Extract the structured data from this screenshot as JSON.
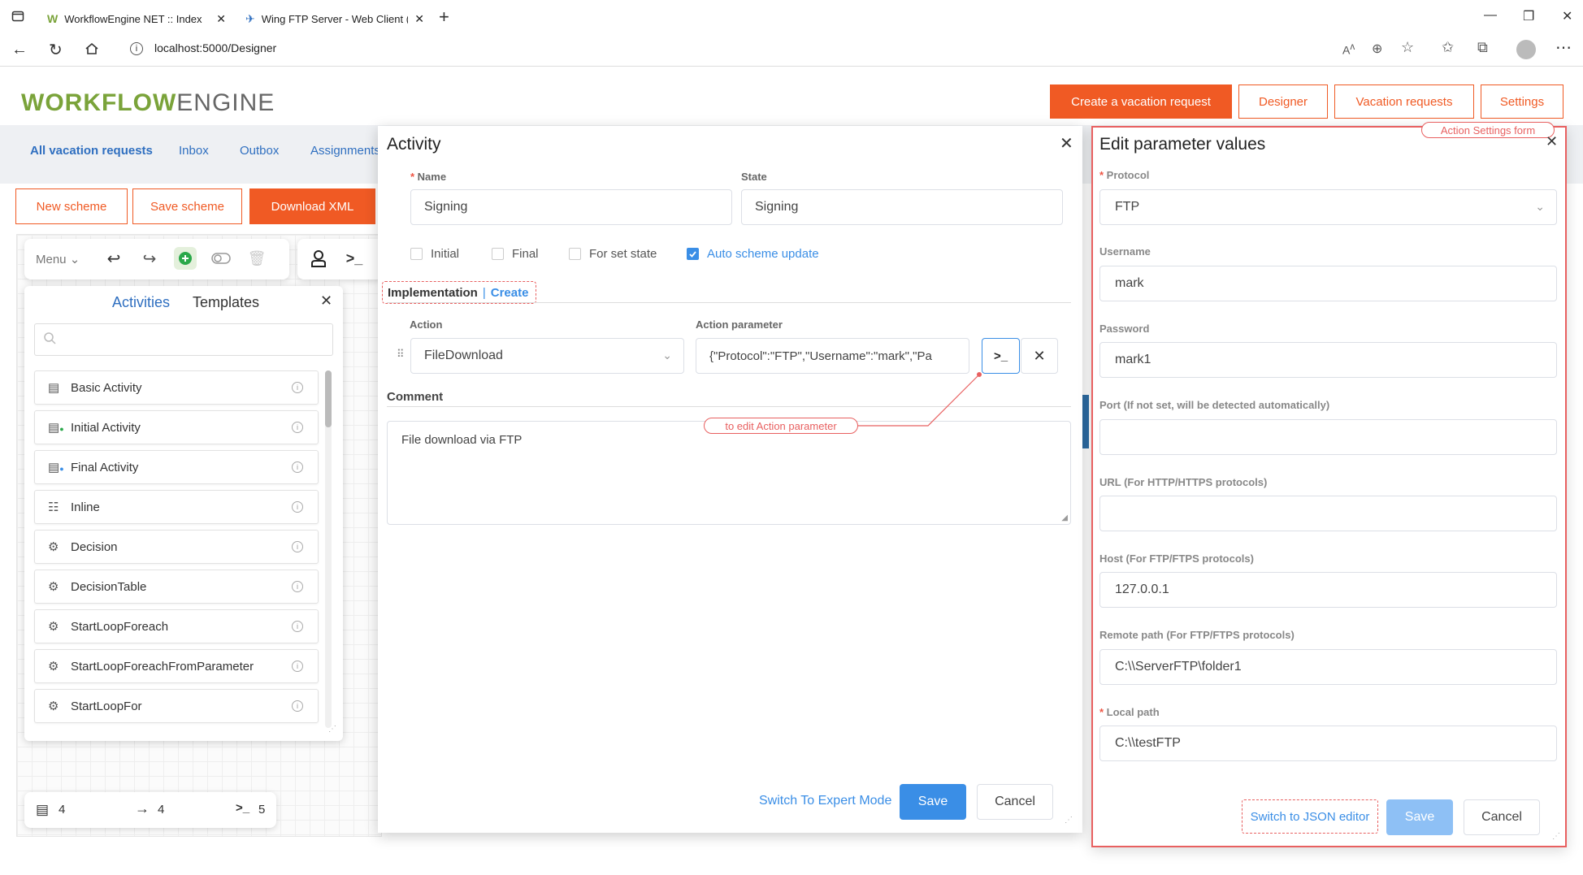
{
  "browser": {
    "tabs": [
      {
        "title": "WorkflowEngine NET :: Index"
      },
      {
        "title": "Wing FTP Server - Web Client (U"
      }
    ],
    "url": "localhost:5000/Designer"
  },
  "header": {
    "logo_bold": "WORKFLOW",
    "logo_light": "ENGINE",
    "buttons": [
      "Create a vacation request",
      "Designer",
      "Vacation requests",
      "Settings"
    ]
  },
  "nav": {
    "items": [
      "All vacation requests",
      "Inbox",
      "Outbox",
      "Assignments"
    ]
  },
  "scheme_buttons": [
    "New scheme",
    "Save scheme",
    "Download XML"
  ],
  "toolbar": {
    "menu_label": "Menu"
  },
  "panel": {
    "tab_activities": "Activities",
    "tab_templates": "Templates",
    "search_placeholder": "",
    "items": [
      "Basic Activity",
      "Initial Activity",
      "Final Activity",
      "Inline",
      "Decision",
      "DecisionTable",
      "StartLoopForeach",
      "StartLoopForeachFromParameter",
      "StartLoopFor"
    ]
  },
  "counters": {
    "activities": "4",
    "transitions": "4",
    "commands": "5"
  },
  "activity": {
    "title": "Activity",
    "name_label": "Name",
    "name_value": "Signing",
    "state_label": "State",
    "state_value": "Signing",
    "checkboxes": [
      {
        "label": "Initial",
        "checked": false
      },
      {
        "label": "Final",
        "checked": false
      },
      {
        "label": "For set state",
        "checked": false
      },
      {
        "label": "Auto scheme update",
        "checked": true
      }
    ],
    "impl_label": "Implementation",
    "impl_link": "Create",
    "action_label": "Action",
    "action_value": "FileDownload",
    "action_param_label": "Action parameter",
    "action_param_value": "{\"Protocol\":\"FTP\",\"Username\":\"mark\",\"Pa",
    "comment_label": "Comment",
    "comment_value": "File download via FTP",
    "annotation": "to edit Action parameter",
    "expert_link": "Switch To Expert Mode",
    "save": "Save",
    "cancel": "Cancel"
  },
  "edit": {
    "title": "Edit parameter values",
    "annotation": "Action Settings form",
    "fields": [
      {
        "label": "Protocol",
        "value": "FTP",
        "required": true
      },
      {
        "label": "Username",
        "value": "mark"
      },
      {
        "label": "Password",
        "value": "mark1"
      },
      {
        "label": "Port (If not set, will be detected automatically)",
        "value": ""
      },
      {
        "label": "URL (For HTTP/HTTPS protocols)",
        "value": ""
      },
      {
        "label": "Host (For FTP/FTPS protocols)",
        "value": "127.0.0.1"
      },
      {
        "label": "Remote path (For FTP/FTPS protocols)",
        "value": "C:\\\\ServerFTP\\folder1"
      },
      {
        "label": "Local path",
        "value": "C:\\\\testFTP",
        "required": true
      }
    ],
    "json_link": "Switch to JSON editor",
    "save": "Save",
    "cancel": "Cancel"
  },
  "colors": {
    "accent": "#f05a24",
    "link": "#2f6fc0",
    "primary": "#3a8ee6",
    "annotation": "#e86060",
    "logo": "#7aa33a"
  }
}
